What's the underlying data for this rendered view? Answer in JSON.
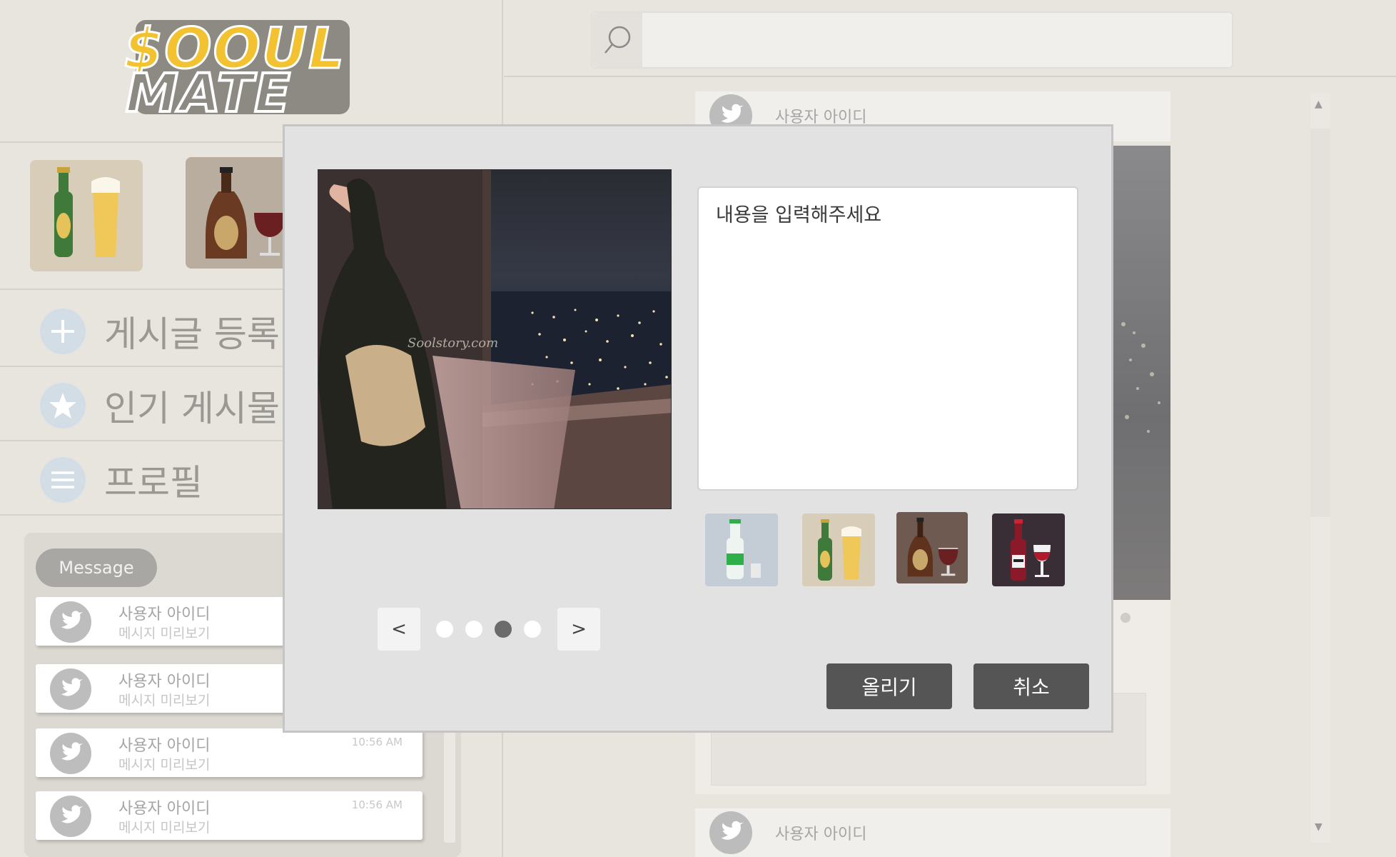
{
  "brand": {
    "logo_line1": "$OOUL",
    "logo_line2": "MATE"
  },
  "sidebar": {
    "categories": [
      {
        "name": "beer-icon"
      },
      {
        "name": "whiskey-icon"
      }
    ],
    "nav": [
      {
        "label": "게시글 등록",
        "icon": "plus-icon"
      },
      {
        "label": "인기 게시물",
        "icon": "star-icon"
      },
      {
        "label": "프로필",
        "icon": "menu-icon"
      }
    ]
  },
  "messages": {
    "tab_label": "Message",
    "items": [
      {
        "user": "사용자 아이디",
        "preview": "메시지 미리보기",
        "time": ""
      },
      {
        "user": "사용자 아이디",
        "preview": "메시지 미리보기",
        "time": ""
      },
      {
        "user": "사용자 아이디",
        "preview": "메시지 미리보기",
        "time": "10:56 AM"
      },
      {
        "user": "사용자 아이디",
        "preview": "메시지 미리보기",
        "time": "10:56 AM"
      }
    ]
  },
  "search": {
    "placeholder": "",
    "icon": "search-icon"
  },
  "feed": {
    "posts": [
      {
        "user": "사용자 아이디"
      },
      {
        "user": "사용자 아이디"
      }
    ]
  },
  "modal": {
    "image_watermark": "Soolstory.com",
    "content_placeholder": "내용을 입력해주세요",
    "drink_options": [
      {
        "name": "soju-icon",
        "bg": "#c4ccd6"
      },
      {
        "name": "beer-icon",
        "bg": "#d8cdb8"
      },
      {
        "name": "whiskey-icon",
        "bg": "#6e5a50"
      },
      {
        "name": "wine-icon",
        "bg": "#3a2e36"
      }
    ],
    "pager": {
      "prev_label": "<",
      "next_label": ">",
      "total": 4,
      "current": 3
    },
    "submit_label": "올리기",
    "cancel_label": "취소"
  },
  "colors": {
    "page_bg": "#e8e4de",
    "modal_bg": "#e2e2e2",
    "button_bg": "#555555",
    "logo_gold": "#f2c230"
  }
}
